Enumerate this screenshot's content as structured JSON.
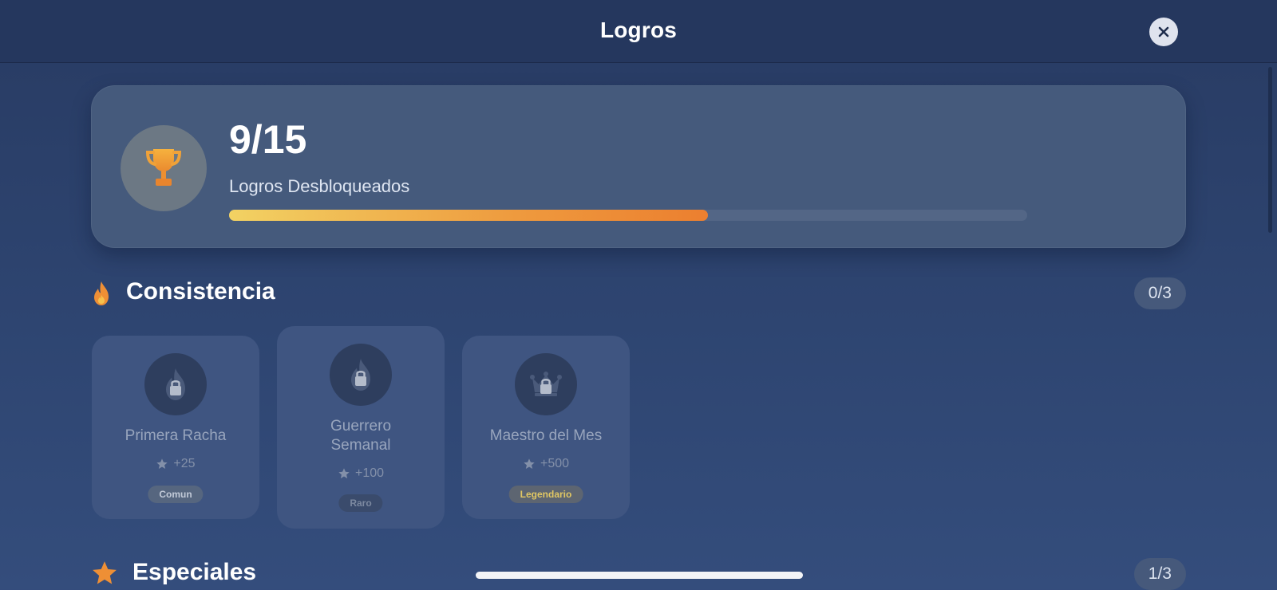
{
  "header": {
    "title": "Logros",
    "close_icon": "close-icon"
  },
  "summary": {
    "count": "9/15",
    "label": "Logros Desbloqueados",
    "progress_fraction": 0.6,
    "icon": "trophy-icon"
  },
  "sections": [
    {
      "title": "Consistencia",
      "badge": "0/3",
      "icon": "flame-icon",
      "achievements": [
        {
          "name": "Primera Racha",
          "points": "+25",
          "rarity": "Comun",
          "icon": "flame-lock-icon"
        },
        {
          "name": "Guerrero Semanal",
          "points": "+100",
          "rarity": "Raro",
          "icon": "flame-lock-icon"
        },
        {
          "name": "Maestro del Mes",
          "points": "+500",
          "rarity": "Legendario",
          "icon": "crown-lock-icon"
        }
      ]
    },
    {
      "title": "Especiales",
      "badge": "1/3",
      "icon": "star-icon"
    }
  ],
  "colors": {
    "accent_orange": "#ee8f35",
    "progress_start": "#f2d263",
    "progress_end": "#ec7f2f",
    "legendary_text": "#e1c763"
  }
}
